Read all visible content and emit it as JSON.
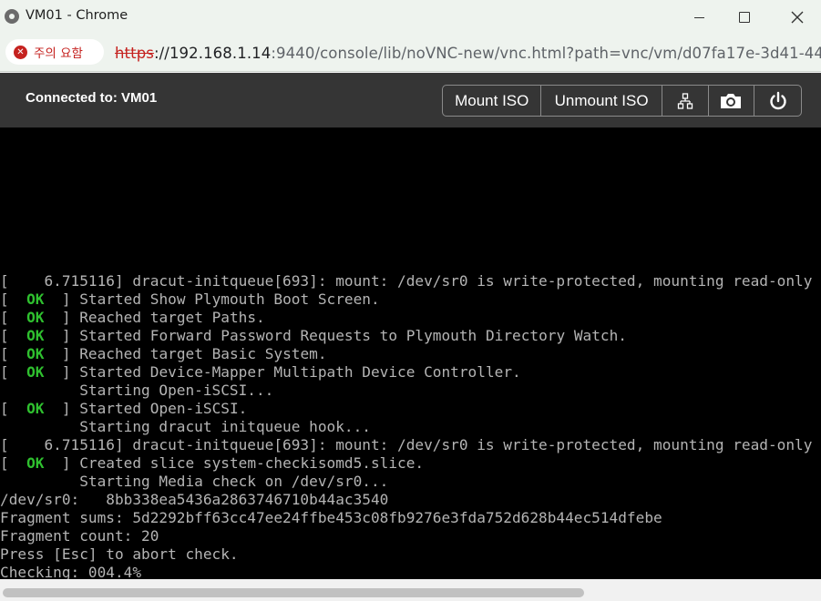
{
  "window": {
    "title": "VM01 - Chrome"
  },
  "addressbar": {
    "security_label": "주의 요함",
    "url_scheme": "https",
    "url_host": "://192.168.1.14",
    "url_rest": ":9440/console/lib/noVNC-new/vnc.html?path=vnc/vm/d07fa17e-3d41-44..."
  },
  "vnc": {
    "status": "Connected to: VM01",
    "buttons": {
      "mount_iso": "Mount ISO",
      "unmount_iso": "Unmount ISO",
      "network_icon": "network-tree-icon",
      "camera_icon": "camera-icon",
      "power_icon": "power-icon"
    }
  },
  "console": {
    "lines": [
      {
        "status": "",
        "text": "[    6.715116] dracut-initqueue[693]: mount: /dev/sr0 is write-protected, mounting read-only"
      },
      {
        "status": "OK",
        "text": "Started Show Plymouth Boot Screen."
      },
      {
        "status": "OK",
        "text": "Reached target Paths."
      },
      {
        "status": "OK",
        "text": "Started Forward Password Requests to Plymouth Directory Watch."
      },
      {
        "status": "OK",
        "text": "Reached target Basic System."
      },
      {
        "status": "OK",
        "text": "Started Device-Mapper Multipath Device Controller."
      },
      {
        "status": "",
        "text": "         Starting Open-iSCSI..."
      },
      {
        "status": "OK",
        "text": "Started Open-iSCSI."
      },
      {
        "status": "",
        "text": "         Starting dracut initqueue hook..."
      },
      {
        "status": "",
        "text": "[    6.715116] dracut-initqueue[693]: mount: /dev/sr0 is write-protected, mounting read-only"
      },
      {
        "status": "OK",
        "text": "Created slice system-checkisomd5.slice."
      },
      {
        "status": "",
        "text": "         Starting Media check on /dev/sr0..."
      },
      {
        "status": "",
        "text": "/dev/sr0:   8bb338ea5436a2863746710b44ac3540"
      },
      {
        "status": "",
        "text": "Fragment sums: 5d2292bff63cc47ee24ffbe453c08fb9276e3fda752d628b44ec514dfebe"
      },
      {
        "status": "",
        "text": "Fragment count: 20"
      },
      {
        "status": "",
        "text": "Press [Esc] to abort check."
      },
      {
        "status": "",
        "text": "Checking: 004.4%"
      }
    ]
  },
  "colors": {
    "ok_green": "#2fc02f",
    "console_text": "#b4b4b4",
    "toolbar_bg": "#353535",
    "warning_red": "#c5221f"
  }
}
